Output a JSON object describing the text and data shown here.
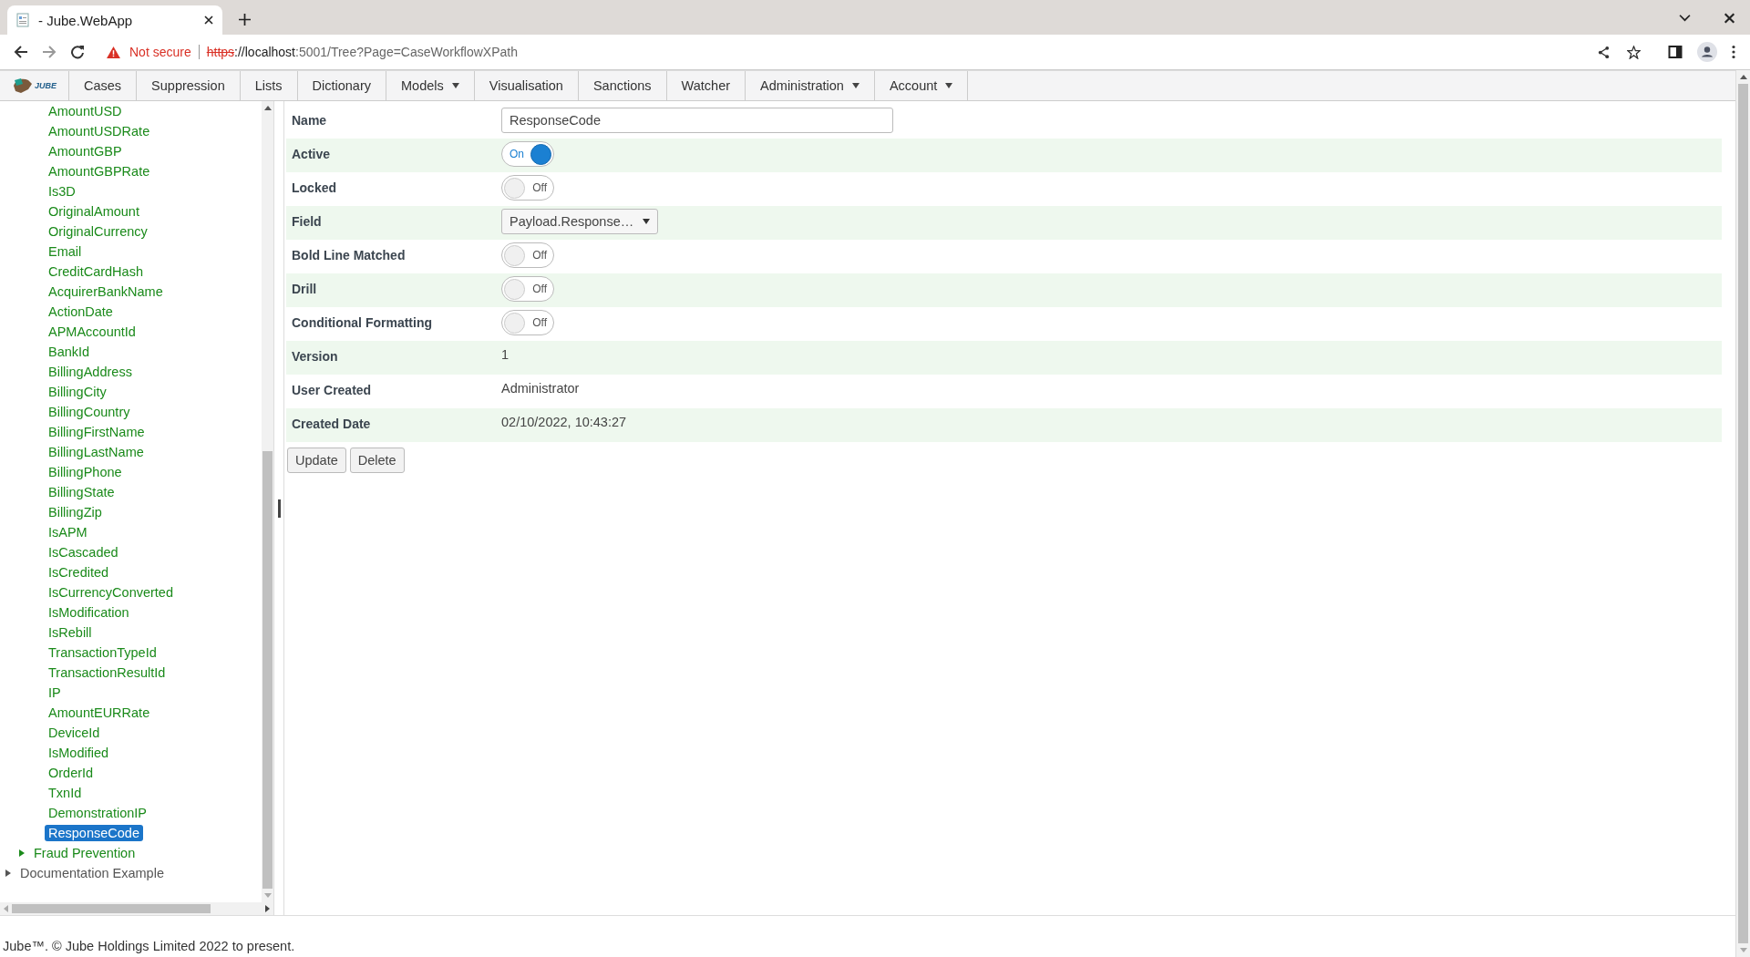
{
  "browser": {
    "tab_title": "- Jube.WebApp",
    "security": "Not secure",
    "url_scheme": "https",
    "url_host": "://localhost",
    "url_rest": ":5001/Tree?Page=CaseWorkflowXPath"
  },
  "nav": {
    "logo_text": "JUBE",
    "items": [
      {
        "label": "Cases",
        "dropdown": false
      },
      {
        "label": "Suppression",
        "dropdown": false
      },
      {
        "label": "Lists",
        "dropdown": false
      },
      {
        "label": "Dictionary",
        "dropdown": false
      },
      {
        "label": "Models",
        "dropdown": true
      },
      {
        "label": "Visualisation",
        "dropdown": false
      },
      {
        "label": "Sanctions",
        "dropdown": false
      },
      {
        "label": "Watcher",
        "dropdown": false
      },
      {
        "label": "Administration",
        "dropdown": true
      },
      {
        "label": "Account",
        "dropdown": true
      }
    ]
  },
  "tree": [
    {
      "children": [
        {
          "children": [
            {
              "label": "AmountUSD",
              "selected": false
            },
            {
              "label": "AmountUSDRate",
              "selected": false
            },
            {
              "label": "AmountGBP",
              "selected": false
            },
            {
              "label": "AmountGBPRate",
              "selected": false
            },
            {
              "label": "Is3D",
              "selected": false
            },
            {
              "label": "OriginalAmount",
              "selected": false
            },
            {
              "label": "OriginalCurrency",
              "selected": false
            },
            {
              "label": "Email",
              "selected": false
            },
            {
              "label": "CreditCardHash",
              "selected": false
            },
            {
              "label": "AcquirerBankName",
              "selected": false
            },
            {
              "label": "ActionDate",
              "selected": false
            },
            {
              "label": "APMAccountId",
              "selected": false
            },
            {
              "label": "BankId",
              "selected": false
            },
            {
              "label": "BillingAddress",
              "selected": false
            },
            {
              "label": "BillingCity",
              "selected": false
            },
            {
              "label": "BillingCountry",
              "selected": false
            },
            {
              "label": "BillingFirstName",
              "selected": false
            },
            {
              "label": "BillingLastName",
              "selected": false
            },
            {
              "label": "BillingPhone",
              "selected": false
            },
            {
              "label": "BillingState",
              "selected": false
            },
            {
              "label": "BillingZip",
              "selected": false
            },
            {
              "label": "IsAPM",
              "selected": false
            },
            {
              "label": "IsCascaded",
              "selected": false
            },
            {
              "label": "IsCredited",
              "selected": false
            },
            {
              "label": "IsCurrencyConverted",
              "selected": false
            },
            {
              "label": "IsModification",
              "selected": false
            },
            {
              "label": "IsRebill",
              "selected": false
            },
            {
              "label": "TransactionTypeId",
              "selected": false
            },
            {
              "label": "TransactionResultId",
              "selected": false
            },
            {
              "label": "IP",
              "selected": false
            },
            {
              "label": "AmountEURRate",
              "selected": false
            },
            {
              "label": "DeviceId",
              "selected": false
            },
            {
              "label": "IsModified",
              "selected": false
            },
            {
              "label": "OrderId",
              "selected": false
            },
            {
              "label": "TxnId",
              "selected": false
            },
            {
              "label": "DemonstrationIP",
              "selected": false
            },
            {
              "label": "ResponseCode",
              "selected": true
            }
          ]
        },
        {
          "label": "Fraud Prevention",
          "expanded": false
        }
      ]
    },
    {
      "label": "Documentation Example",
      "expanded": false
    }
  ],
  "form": {
    "rows": [
      {
        "label": "Name",
        "kind": "text",
        "value": "ResponseCode"
      },
      {
        "label": "Active",
        "kind": "toggle",
        "on": true,
        "value": "On"
      },
      {
        "label": "Locked",
        "kind": "toggle",
        "on": false,
        "value": "Off"
      },
      {
        "label": "Field",
        "kind": "select",
        "value": "Payload.Response…"
      },
      {
        "label": "Bold Line Matched",
        "kind": "toggle",
        "on": false,
        "value": "Off"
      },
      {
        "label": "Drill",
        "kind": "toggle",
        "on": false,
        "value": "Off"
      },
      {
        "label": "Conditional Formatting",
        "kind": "toggle",
        "on": false,
        "value": "Off"
      },
      {
        "label": "Version",
        "kind": "value",
        "value": "1"
      },
      {
        "label": "User Created",
        "kind": "value",
        "value": "Administrator"
      },
      {
        "label": "Created Date",
        "kind": "value",
        "value": "02/10/2022, 10:43:27"
      }
    ],
    "buttons": [
      "Update",
      "Delete"
    ]
  },
  "footer": "Jube™. © Jube Holdings Limited 2022 to present."
}
